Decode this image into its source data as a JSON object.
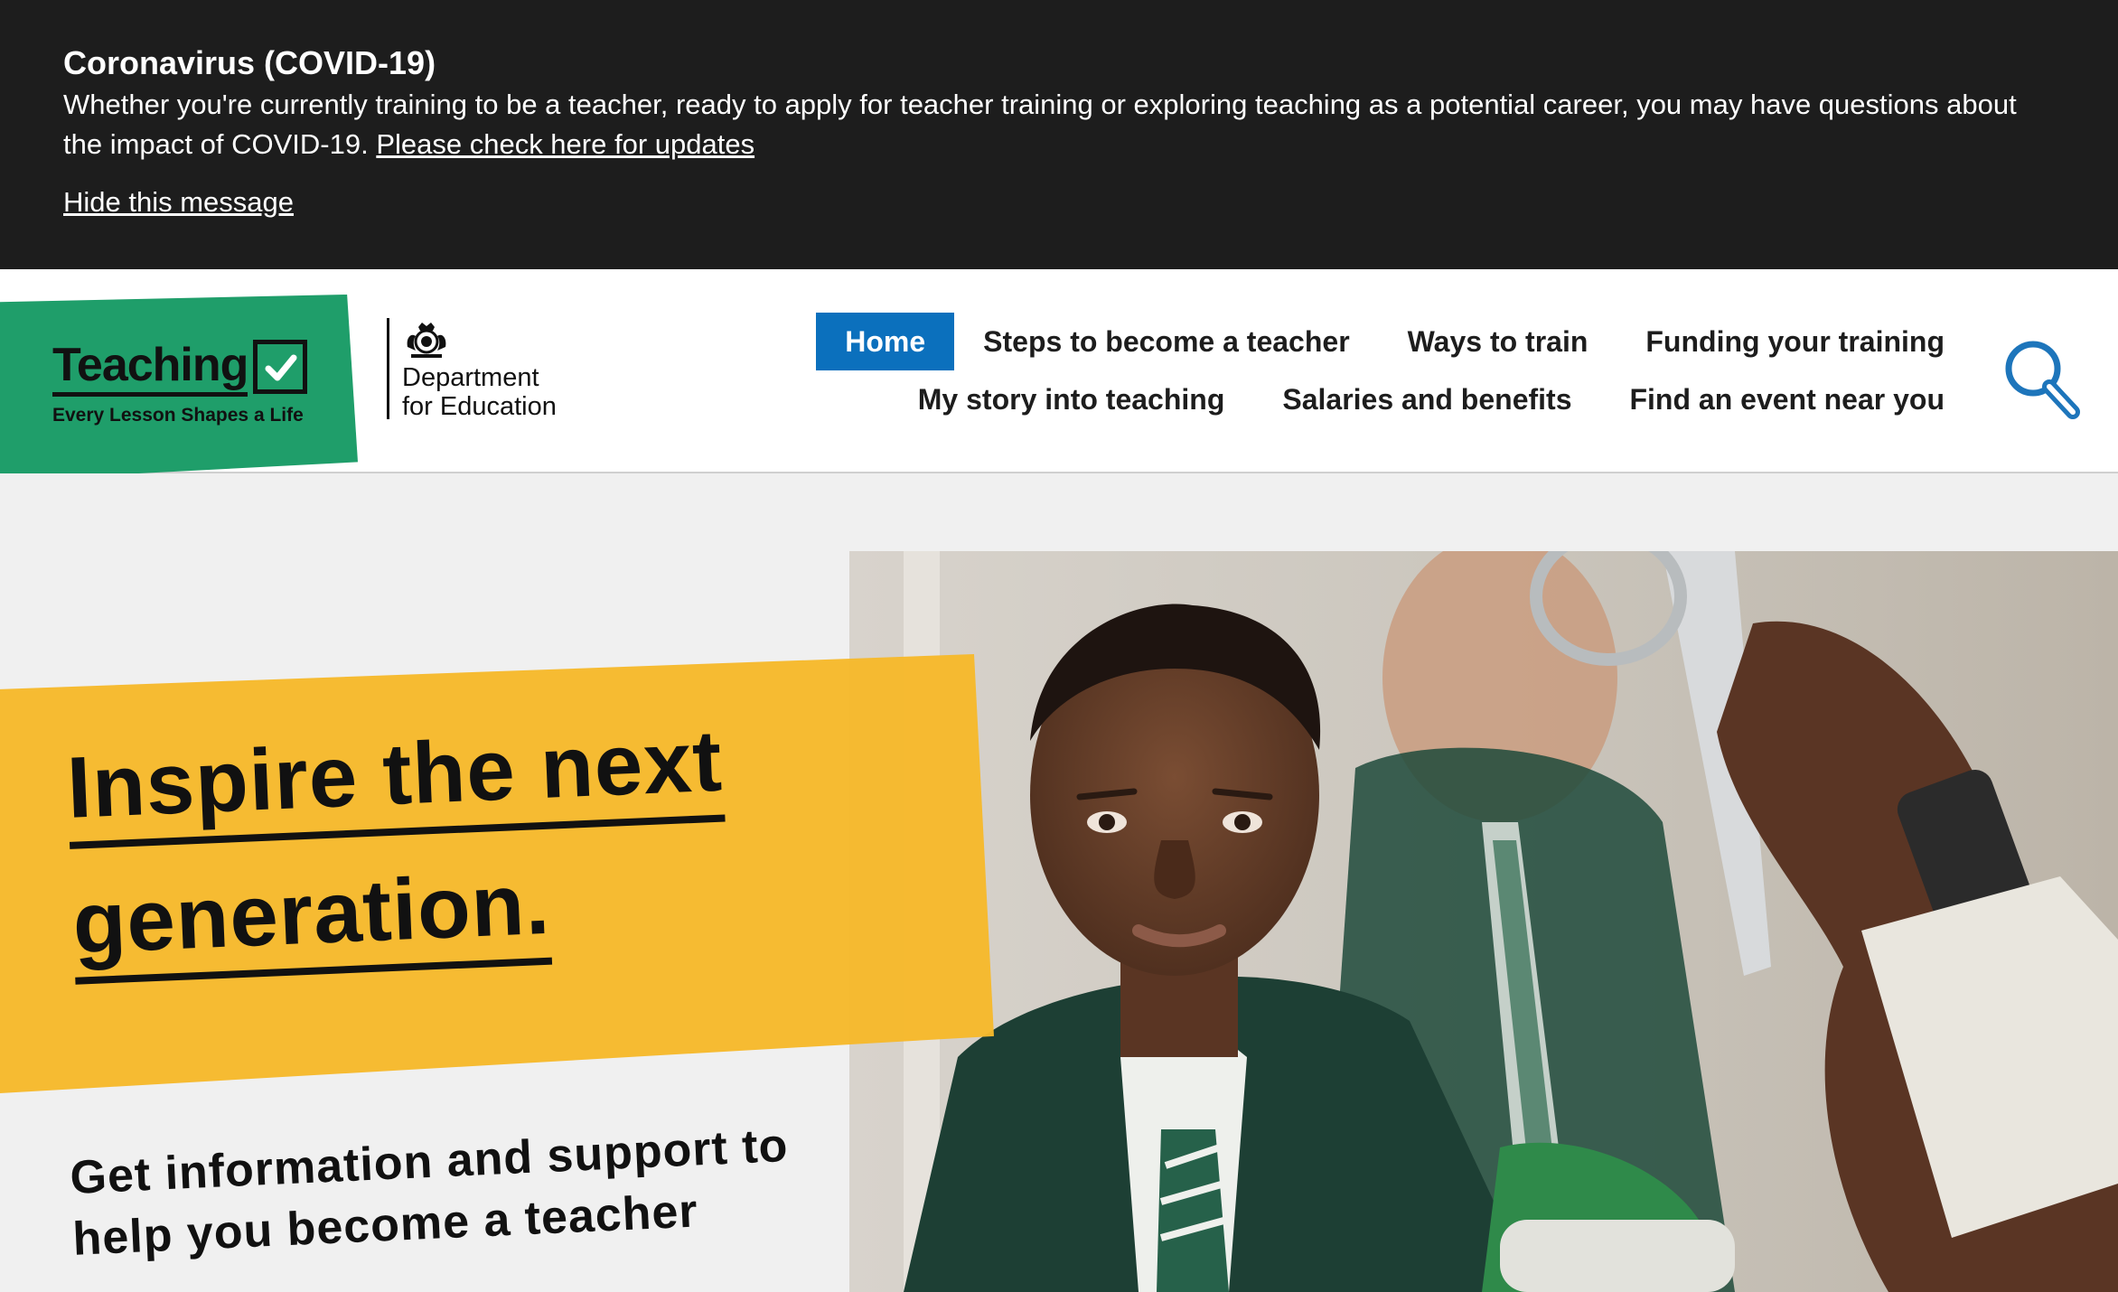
{
  "covid_banner": {
    "title": "Coronavirus (COVID-19)",
    "text": "Whether you're currently training to be a teacher, ready to apply for teacher training or exploring teaching as a potential career, you may have questions about the impact of COVID-19.",
    "link_label": "Please check here for updates",
    "hide_label": "Hide this message"
  },
  "brand": {
    "logo_word": "Teaching",
    "tagline": "Every Lesson Shapes a Life",
    "dfe_line1": "Department",
    "dfe_line2": "for Education",
    "green": "#1f9e6a"
  },
  "nav": {
    "row1": [
      "Home",
      "Steps to become a teacher",
      "Ways to train",
      "Funding your training"
    ],
    "row2": [
      "My story into teaching",
      "Salaries and benefits",
      "Find an event near you"
    ],
    "active": "Home",
    "active_color": "#0b70bd"
  },
  "hero": {
    "headline_line1": "Inspire the next",
    "headline_line2": "generation.",
    "subheading": "Get information and support to help you become a teacher",
    "yellow": "#f6b92b"
  }
}
